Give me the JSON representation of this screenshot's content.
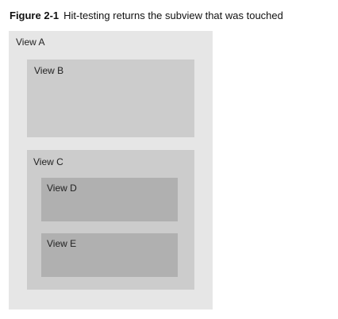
{
  "caption": {
    "figure_label": "Figure 2-1",
    "text": "Hit-testing returns the subview that was touched"
  },
  "views": {
    "a": {
      "label": "View A",
      "color": "#e6e6e6"
    },
    "b": {
      "label": "View B",
      "color": "#cccccc"
    },
    "c": {
      "label": "View C",
      "color": "#cccccc"
    },
    "d": {
      "label": "View D",
      "color": "#b0b0b0"
    },
    "e": {
      "label": "View E",
      "color": "#b0b0b0"
    }
  }
}
